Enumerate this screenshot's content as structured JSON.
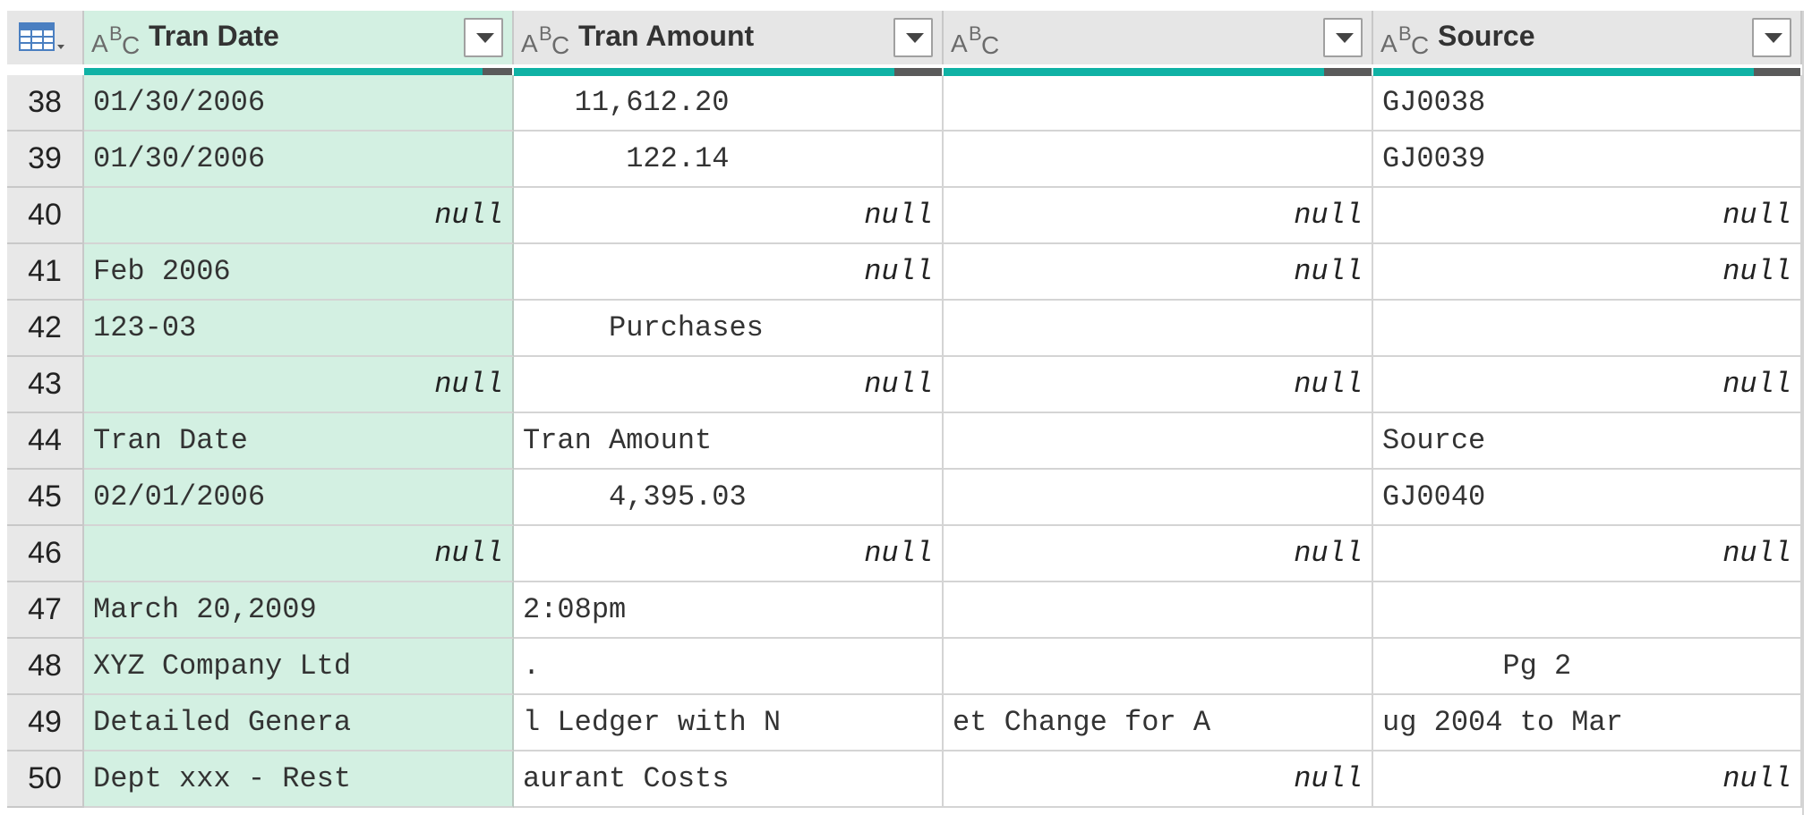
{
  "columns": [
    {
      "type_icon": "abc-text-icon",
      "label": "Tran Date"
    },
    {
      "type_icon": "abc-text-icon",
      "label": "Tran Amount"
    },
    {
      "type_icon": "abc-text-icon",
      "label": ""
    },
    {
      "type_icon": "abc-text-icon",
      "label": "Source"
    }
  ],
  "quality_bar": [
    {
      "valid_fraction": 0.93
    },
    {
      "valid_fraction": 0.89
    },
    {
      "valid_fraction": 0.89
    },
    {
      "valid_fraction": 0.89
    }
  ],
  "rows": [
    {
      "n": "38",
      "c": [
        "01/30/2006",
        "   11,612.20",
        "",
        "GJ0038"
      ]
    },
    {
      "n": "39",
      "c": [
        "01/30/2006",
        "      122.14",
        "",
        "GJ0039"
      ]
    },
    {
      "n": "40",
      "c": [
        "null",
        "null",
        "null",
        "null"
      ]
    },
    {
      "n": "41",
      "c": [
        "Feb 2006",
        "null",
        "null",
        "null"
      ]
    },
    {
      "n": "42",
      "c": [
        "123-03",
        "     Purchases",
        "",
        ""
      ]
    },
    {
      "n": "43",
      "c": [
        "null",
        "null",
        "null",
        "null"
      ]
    },
    {
      "n": "44",
      "c": [
        "Tran Date",
        "Tran Amount",
        "",
        "Source"
      ]
    },
    {
      "n": "45",
      "c": [
        "02/01/2006",
        "     4,395.03",
        "",
        "GJ0040"
      ]
    },
    {
      "n": "46",
      "c": [
        "null",
        "null",
        "null",
        "null"
      ]
    },
    {
      "n": "47",
      "c": [
        "March 20,2009",
        "2:08pm",
        "",
        ""
      ]
    },
    {
      "n": "48",
      "c": [
        "XYZ Company Ltd",
        ".",
        "",
        "       Pg 2"
      ]
    },
    {
      "n": "49",
      "c": [
        "Detailed Genera",
        "l Ledger with N",
        "et Change for A",
        "ug 2004 to Mar"
      ]
    },
    {
      "n": "50",
      "c": [
        "Dept xxx - Rest",
        "aurant Costs",
        "null",
        "null"
      ]
    }
  ]
}
